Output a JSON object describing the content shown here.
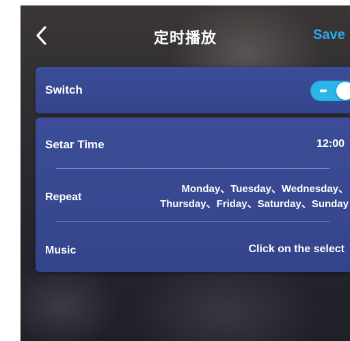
{
  "header": {
    "title": "定时播放",
    "save_label": "Save"
  },
  "switch_row": {
    "label": "Switch",
    "state": "on",
    "toggle_color": "#2cb5e8"
  },
  "settings": {
    "time": {
      "label": "Setar Time",
      "value": "12:00"
    },
    "repeat": {
      "label": "Repeat",
      "days_line1": "Monday、Tuesday、Wednesday、",
      "days_line2": "Thursday、Friday、Saturday、Sunday"
    },
    "music": {
      "label": "Music",
      "value": "Click on the select"
    }
  },
  "colors": {
    "card": "#3a4a93",
    "accent": "#2ba8ee",
    "text": "#ffffff"
  },
  "icons": {
    "back": "chevron-left-icon"
  }
}
